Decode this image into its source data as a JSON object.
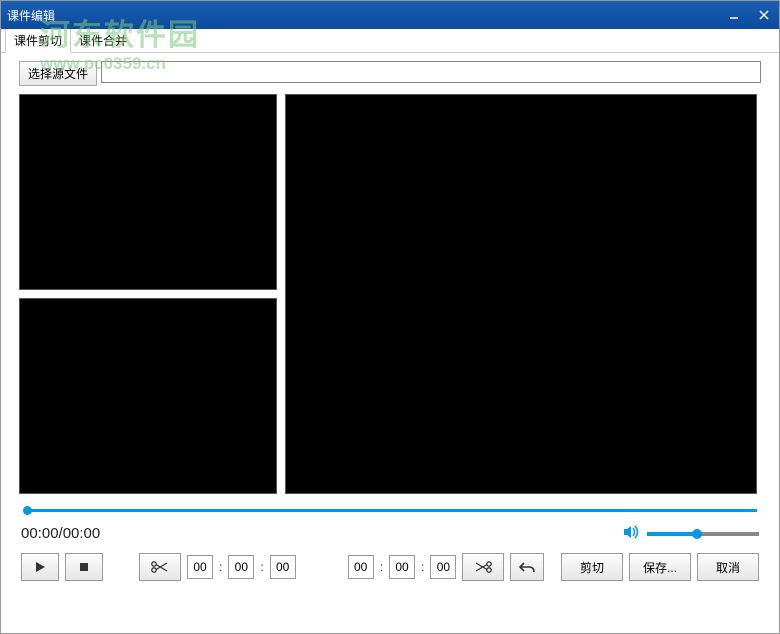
{
  "window": {
    "title": "课件编辑"
  },
  "tabs": {
    "cut": "课件剪切",
    "merge": "课件合并"
  },
  "file": {
    "select_label": "选择源文件",
    "path": ""
  },
  "time": {
    "display": "00:00/00:00"
  },
  "clip": {
    "start_hh": "00",
    "start_mm": "00",
    "start_ss": "00",
    "end_hh": "00",
    "end_mm": "00",
    "end_ss": "00"
  },
  "actions": {
    "cut": "剪切",
    "save": "保存...",
    "cancel": "取消"
  },
  "watermark": {
    "cn": "河东软件园",
    "url": "www.pc0359.cn"
  }
}
